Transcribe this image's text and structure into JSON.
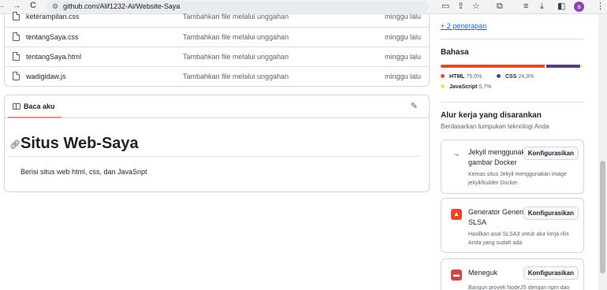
{
  "browser": {
    "back_glyph": "←",
    "forward_glyph": "→",
    "reload_glyph": "C",
    "url": "github.com/Alif1232-Al/Website-Saya",
    "avatar_letter": "a"
  },
  "files": [
    {
      "name": "keterampilan.css",
      "message": "Tambahkan file melalui unggahan",
      "date": "minggu lalu"
    },
    {
      "name": "tentangSaya.css",
      "message": "Tambahkan file melalui unggahan",
      "date": "minggu lalu"
    },
    {
      "name": "tentangSaya.html",
      "message": "Tambahkan file melalui unggahan",
      "date": "minggu lalu"
    },
    {
      "name": "wadigidaw.js",
      "message": "Tambahkan file melalui unggahan",
      "date": "minggu lalu"
    }
  ],
  "readme": {
    "tab_label": "Baca aku",
    "title": "Situs Web-Saya",
    "body": "Berisi situs web html, css, dan JavaSript"
  },
  "sidebar": {
    "deployments_link": "+ 2 penerapan",
    "languages_heading": "Bahasa",
    "languages": [
      {
        "name": "HTML",
        "percent": "75,0%",
        "value": 75.0,
        "color": "#e34c26"
      },
      {
        "name": "CSS",
        "percent": "24,3%",
        "value": 24.3,
        "color": "#563d7c"
      },
      {
        "name": "JavaScript",
        "percent": "0,7%",
        "value": 0.7,
        "color": "#f1e05a"
      }
    ],
    "workflows_heading": "Alur kerja yang disarankan",
    "workflows_sub": "Berdasarkan tumpukan teknologi Anda",
    "workflows": [
      {
        "title": "Jekyll menggunakan gambar Docker",
        "button": "Konfigurasikan",
        "description": "Kemas situs Jekyll menggunakan image jekyll/builder Docker.",
        "icon": "jekyll-icon"
      },
      {
        "title": "Generator Generik SLSA",
        "button": "Konfigurasikan",
        "description": "Hasilkan asal SLSA3 untuk alur kerja rilis Anda yang sudah ada",
        "icon": "slsa-icon"
      },
      {
        "title": "Meneguk",
        "button": "Konfigurasikan",
        "description": "Bangun proyek NodeJS dengan npm dan",
        "icon": "gulp-icon"
      }
    ]
  }
}
